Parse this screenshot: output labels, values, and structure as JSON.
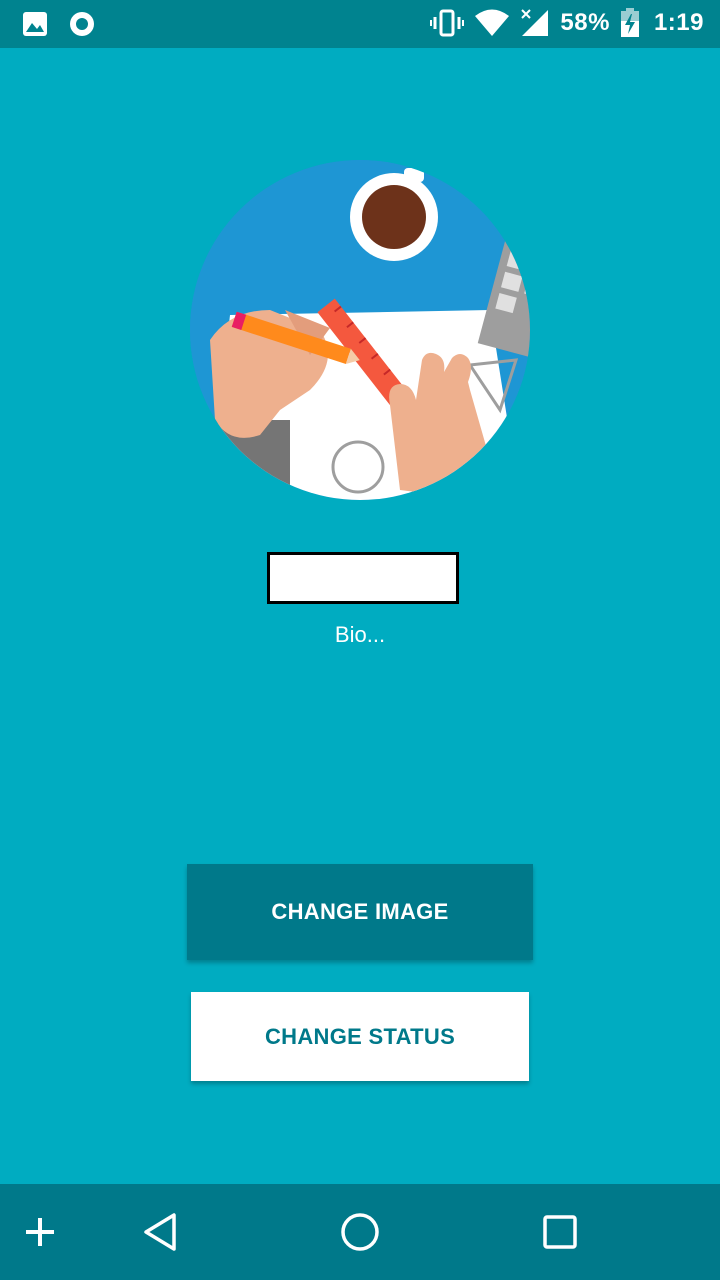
{
  "status_bar": {
    "left_icons": [
      "image-icon",
      "record-icon"
    ],
    "right_icons": [
      "vibrate-icon",
      "wifi-icon",
      "signal-icon",
      "battery-charging-icon"
    ],
    "battery_percent": "58%",
    "time": "1:19"
  },
  "profile": {
    "avatar_icon": "desk-drawing-illustration",
    "name_value": "",
    "bio": "Bio..."
  },
  "buttons": {
    "change_image": "CHANGE IMAGE",
    "change_status": "CHANGE STATUS"
  },
  "nav_bar": {
    "icons": [
      "plus-icon",
      "back-icon",
      "home-icon",
      "recents-icon"
    ]
  },
  "colors": {
    "background": "#00acc1",
    "status_bar": "#00838f",
    "primary_dark": "#00798a",
    "white": "#ffffff"
  }
}
